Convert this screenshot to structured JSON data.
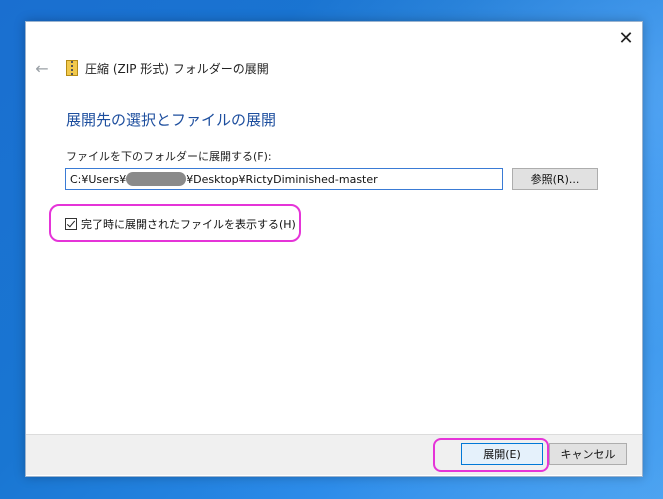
{
  "window": {
    "title": "圧縮 (ZIP 形式) フォルダーの展開",
    "close_glyph": "✕",
    "back_glyph": "←"
  },
  "content": {
    "heading": "展開先の選択とファイルの展開",
    "path_label": "ファイルを下のフォルダーに展開する(F):",
    "path_prefix": "C:¥Users¥",
    "path_suffix": "¥Desktop¥RictyDiminished-master",
    "browse_label": "参照(R)...",
    "checkbox_label": "完了時に展開されたファイルを表示する(H)",
    "checkbox_checked": true
  },
  "footer": {
    "extract_label": "展開(E)",
    "cancel_label": "キャンセル"
  },
  "colors": {
    "heading": "#1d4e9e",
    "highlight": "#e534d8",
    "primary_button_border": "#0078d7"
  },
  "icons": {
    "back": "back-arrow-icon",
    "zip": "zip-folder-icon",
    "close": "close-icon",
    "check": "checkmark-icon"
  }
}
